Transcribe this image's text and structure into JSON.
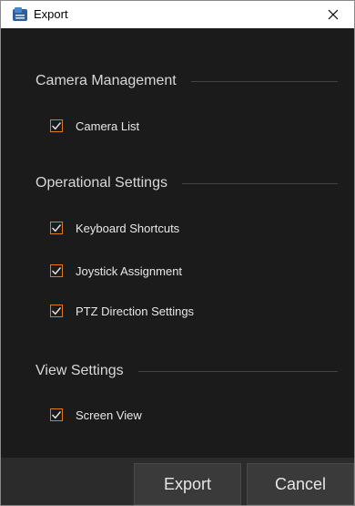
{
  "window": {
    "title": "Export",
    "app_icon": "export-app-icon",
    "close_icon": "close-icon"
  },
  "sections": [
    {
      "title": "Camera Management",
      "items": [
        {
          "label": "Camera List",
          "checked": true
        }
      ]
    },
    {
      "title": "Operational Settings",
      "items": [
        {
          "label": "Keyboard Shortcuts",
          "checked": true
        },
        {
          "label": "Joystick Assignment",
          "checked": true
        },
        {
          "label": "PTZ Direction Settings",
          "checked": true
        }
      ]
    },
    {
      "title": "View Settings",
      "items": [
        {
          "label": "Screen View",
          "checked": true
        }
      ]
    }
  ],
  "footer": {
    "export_label": "Export",
    "cancel_label": "Cancel"
  },
  "colors": {
    "accent": "#e07a1f",
    "background": "#1b1b1b",
    "footer": "#2b2b2b"
  }
}
